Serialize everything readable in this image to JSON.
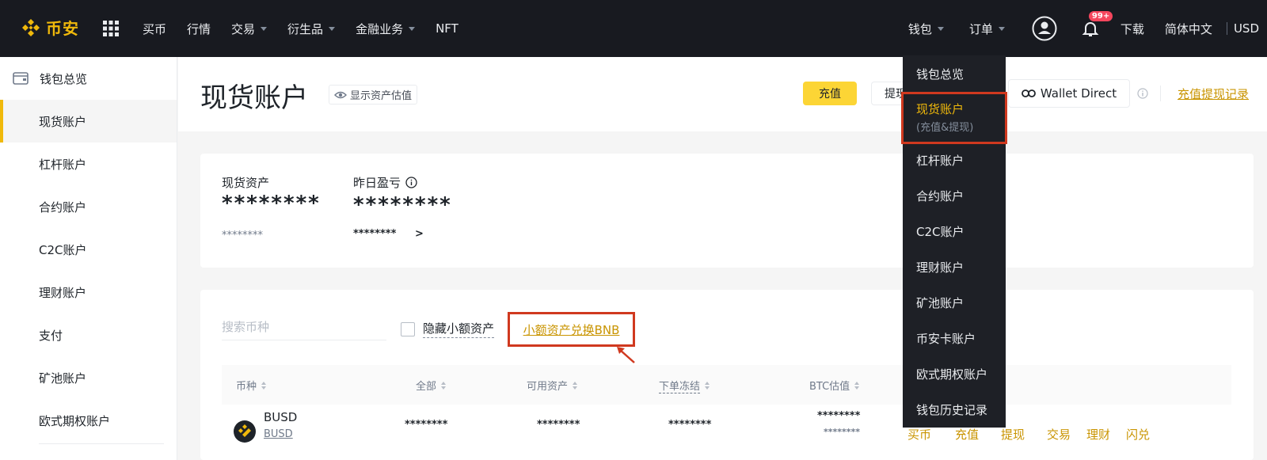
{
  "topbar": {
    "logo_text": "币安",
    "nav": [
      {
        "label": "买币",
        "dropdown": false
      },
      {
        "label": "行情",
        "dropdown": false
      },
      {
        "label": "交易",
        "dropdown": true
      },
      {
        "label": "衍生品",
        "dropdown": true
      },
      {
        "label": "金融业务",
        "dropdown": true
      },
      {
        "label": "NFT",
        "dropdown": false
      }
    ],
    "wallet": "钱包",
    "orders": "订单",
    "notification_badge": "99+",
    "download": "下载",
    "language": "简体中文",
    "currency": "USD"
  },
  "sidebar": {
    "items": [
      "钱包总览",
      "现货账户",
      "杠杆账户",
      "合约账户",
      "C2C账户",
      "理财账户",
      "支付",
      "矿池账户",
      "欧式期权账户"
    ],
    "active_index": 1
  },
  "header": {
    "title": "现货账户",
    "show_estimate": "显示资产估值",
    "deposit": "充值",
    "withdraw": "提现",
    "wallet_direct": "Wallet Direct",
    "history": "充值提现记录"
  },
  "summary": {
    "spot_label": "现货资产",
    "spot_value": "********",
    "spot_sub": "********",
    "pnl_label": "昨日盈亏",
    "pnl_value": "********",
    "pnl_sub": "********",
    "pnl_chevron": ">"
  },
  "table": {
    "search_placeholder": "搜索币种",
    "hide_small": "隐藏小额资产",
    "convert_small": "小额资产兑换BNB",
    "headers": [
      "币种",
      "全部",
      "可用资产",
      "下单冻结",
      "BTC估值"
    ],
    "row": {
      "coin": "BUSD",
      "coin_full": "BUSD",
      "total": "********",
      "available": "********",
      "frozen": "********",
      "btc": "********",
      "btc_sub": "********"
    },
    "actions": [
      "买币",
      "充值",
      "提现",
      "交易",
      "理财",
      "闪兑"
    ]
  },
  "dropdown": {
    "items": [
      "钱包总览",
      "现货账户",
      "杠杆账户",
      "合约账户",
      "C2C账户",
      "理财账户",
      "矿池账户",
      "币安卡账户",
      "欧式期权账户",
      "钱包历史记录"
    ],
    "selected_sub": "(充值&提现)"
  },
  "colors": {
    "brand": "#f0b90b",
    "topbar_bg": "#181a20",
    "highlight_box": "#d0391f",
    "link": "#c99400"
  }
}
